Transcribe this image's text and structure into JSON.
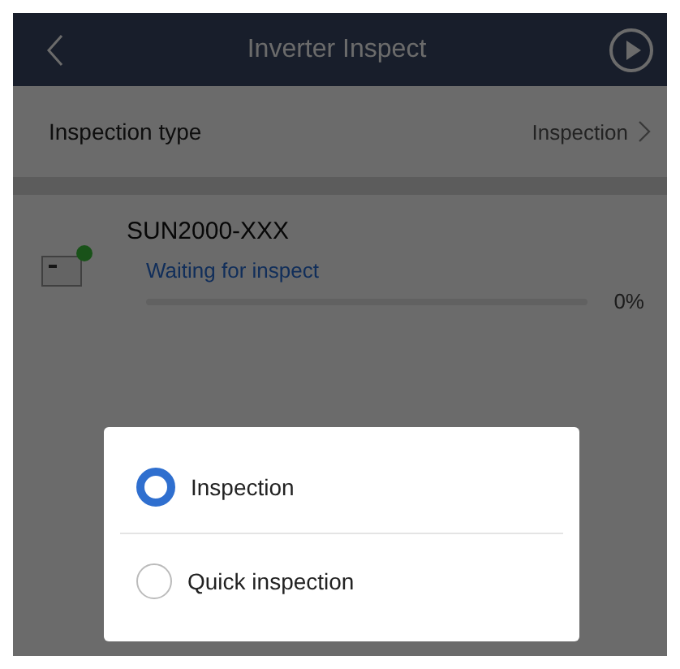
{
  "header": {
    "title": "Inverter Inspect"
  },
  "inspection_type": {
    "label": "Inspection type",
    "value": "Inspection"
  },
  "device": {
    "name": "SUN2000-XXX",
    "status": "Waiting for inspect",
    "level": 0,
    "percent": "0%",
    "online": true
  },
  "dialog": {
    "options": [
      {
        "label": "Inspection",
        "selected": true
      },
      {
        "label": "Quick inspection",
        "selected": false
      }
    ]
  }
}
